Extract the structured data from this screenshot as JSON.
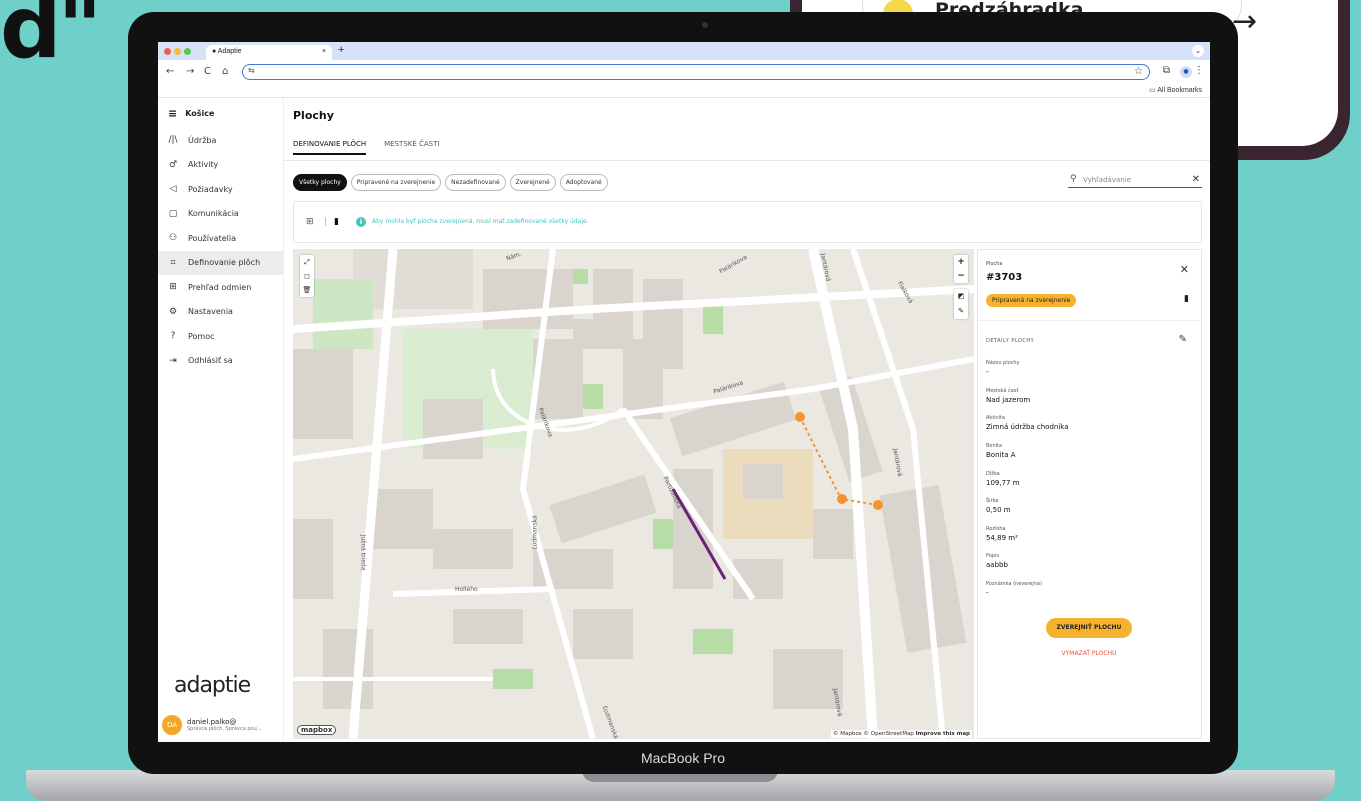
{
  "decor": {
    "headline_glyph": "d\"",
    "phone_card_text": "Predzáhradka",
    "laptop_brand": "MacBook Pro"
  },
  "browser": {
    "tab_title": "Adaptie",
    "bookmarks_label": "All Bookmarks",
    "nav": {
      "back": "←",
      "forward": "→",
      "reload": "C",
      "home": "⌂"
    }
  },
  "sidebar": {
    "city": "Košice",
    "items": [
      {
        "label": "Údržba",
        "icon": "wrench-icon"
      },
      {
        "label": "Aktivity",
        "icon": "activity-icon"
      },
      {
        "label": "Požiadavky",
        "icon": "megaphone-icon"
      },
      {
        "label": "Komunikácia",
        "icon": "chat-icon"
      },
      {
        "label": "Používatelia",
        "icon": "users-icon"
      },
      {
        "label": "Definovanie plôch",
        "icon": "area-icon"
      },
      {
        "label": "Prehľad odmien",
        "icon": "gift-icon"
      },
      {
        "label": "Nastavenia",
        "icon": "gear-icon"
      },
      {
        "label": "Pomoc",
        "icon": "help-icon"
      },
      {
        "label": "Odhlásiť sa",
        "icon": "logout-icon"
      }
    ],
    "active_index": 5,
    "logo": "adaptie",
    "user": {
      "initials": "DA",
      "name": "daniel.palko@",
      "role": "Správca plôch, Správca pou..."
    }
  },
  "main": {
    "title": "Plochy",
    "tabs": [
      "DEFINOVANIE PLÔCH",
      "MESTSKÉ ČASTI"
    ],
    "active_tab": 0,
    "filters": [
      "Všetky plochy",
      "Pripravené na zverejnenie",
      "Nezadefinované",
      "Zverejnené",
      "Adoptované"
    ],
    "active_filter": 0,
    "search_placeholder": "Vyhľadávanie",
    "info_message": "Aby mohla byť plocha zverejnená, musí mať zadefinované všetky údaje."
  },
  "map": {
    "streets": [
      "Palárikova",
      "Palárikova",
      "Palárikova",
      "Jantárová",
      "Jantárová",
      "Jantárová",
      "Fialková",
      "Južná trieda",
      "Ľudmanská",
      "Ľudmanská",
      "Hollého",
      "Partizánska",
      "Nám."
    ],
    "mapbox_logo": "mapbox",
    "attribution": "© Mapbox © OpenStreetMap",
    "improve": "Improve this map",
    "controls": {
      "zoom_in": "+",
      "zoom_out": "−"
    }
  },
  "detail": {
    "type_label": "Plocha",
    "id": "#3703",
    "status": "Pripravená na zverejnenie",
    "section": "DETAILY PLOCHY",
    "fields": [
      {
        "label": "Názov plochy",
        "value": "-"
      },
      {
        "label": "Mestská časť",
        "value": "Nad jazerom"
      },
      {
        "label": "Aktivita",
        "value": "Zimná údržba chodníka"
      },
      {
        "label": "Bonita",
        "value": "Bonita A"
      },
      {
        "label": "Dĺžka",
        "value": "109,77 m"
      },
      {
        "label": "Šírka",
        "value": "0,50 m"
      },
      {
        "label": "Rozloha",
        "value": "54,89 m²"
      },
      {
        "label": "Popis",
        "value": "aabbb"
      },
      {
        "label": "Poznámka (neverejná)",
        "value": "-"
      }
    ],
    "publish_button": "ZVEREJNIŤ PLOCHU",
    "delete_button": "VYMAZAŤ PLOCHU"
  },
  "colors": {
    "accent": "#f6b22e",
    "info": "#48c3bc",
    "delete": "#e8553d",
    "route": "#6d1f7a",
    "marker": "#f59331"
  }
}
